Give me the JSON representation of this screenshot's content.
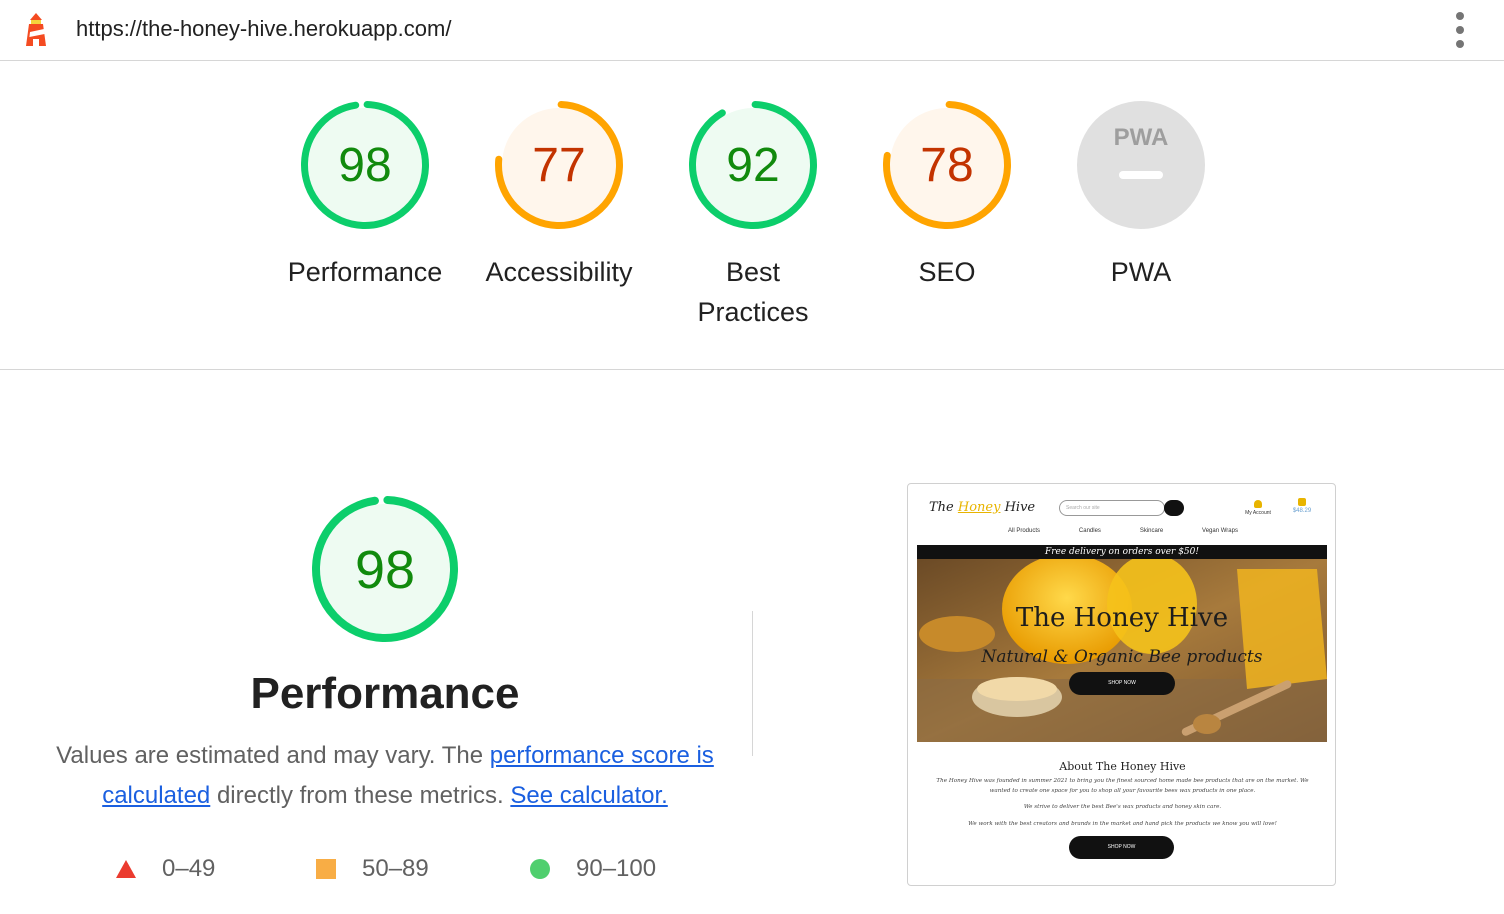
{
  "toolbar": {
    "url": "https://the-honey-hive.herokuapp.com/",
    "logo_icon": "lighthouse-icon",
    "menu_icon": "more-vert-icon"
  },
  "gauges": [
    {
      "label": "Performance",
      "score": 98,
      "rating": "pass"
    },
    {
      "label": "Accessibility",
      "score": 77,
      "rating": "average"
    },
    {
      "label": "Best Practices",
      "score": 92,
      "rating": "pass"
    },
    {
      "label": "SEO",
      "score": 78,
      "rating": "average"
    },
    {
      "label": "PWA",
      "score": null,
      "rating": "na",
      "badge_text": "PWA"
    }
  ],
  "colors": {
    "pass": "#0cce6b",
    "pass_text": "#118a0d",
    "pass_bg": "#eefbf2",
    "average": "#ffa400",
    "average_text": "#c33300",
    "average_bg": "#fff6ec",
    "fail": "#ff4e42",
    "na": "#e0e0e0",
    "link": "#1a5fe0"
  },
  "performance": {
    "score": 98,
    "title": "Performance",
    "desc_part1": "Values are estimated and may vary. The ",
    "desc_link1": "performance score is calculated",
    "desc_part2": " directly from these metrics. ",
    "desc_link2": "See calculator."
  },
  "legend": [
    {
      "range": "0–49",
      "shape": "triangle",
      "icon": "fail-triangle-icon"
    },
    {
      "range": "50–89",
      "shape": "square",
      "icon": "average-square-icon"
    },
    {
      "range": "90–100",
      "shape": "circle",
      "icon": "pass-circle-icon"
    }
  ],
  "screenshot": {
    "brand_pre": "The ",
    "brand_honey": "Honey",
    "brand_post": " Hive",
    "search_placeholder": "Search our site",
    "account_label": "My Account",
    "cart_total": "$48.29",
    "nav": [
      "All Products",
      "Candles",
      "Skincare",
      "Vegan Wraps"
    ],
    "banner": "Free delivery on orders over $50!",
    "hero_title": "The Honey Hive",
    "hero_subtitle": "Natural & Organic Bee products",
    "shop_now": "SHOP NOW",
    "about_title": "About The Honey Hive",
    "about_p1": "The Honey Hive was founded in summer 2021 to bring you the finest sourced home made bee products that are on the market. We wanted to create one space for you to shop all your favourite bees wax products in one place.",
    "about_p2": "We strive to deliver the best Bee's wax products and honey skin care.",
    "about_p3": "We work with the best creators and brands in the market and hand pick the products we know you will love!"
  }
}
